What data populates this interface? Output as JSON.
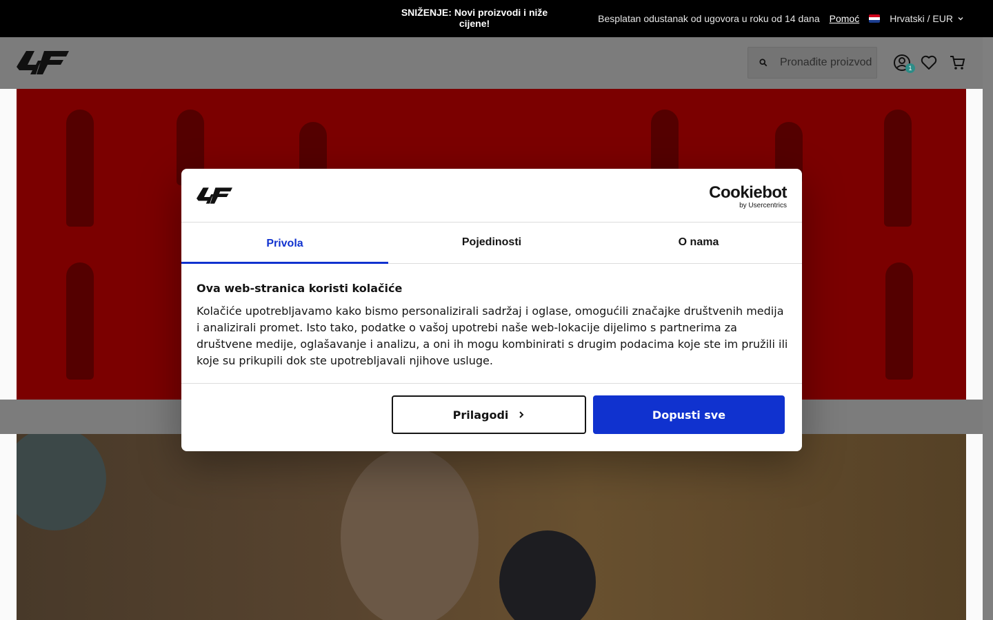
{
  "topbar": {
    "promo": "SNIŽENJE: Novi proizvodi i niže cijene!",
    "returns": "Besplatan odustanak od ugovora u roku od 14 dana",
    "help": "Pomoć",
    "language": "Hrvatski / EUR"
  },
  "header": {
    "logo": "4F",
    "search_placeholder": "Pronađite proizvod",
    "cart_badge": "1"
  },
  "cookie_dialog": {
    "brand": "Cookiebot",
    "brand_sub": "by Usercentrics",
    "tabs": [
      {
        "label": "Privola",
        "active": true
      },
      {
        "label": "Pojedinosti",
        "active": false
      },
      {
        "label": "O nama",
        "active": false
      }
    ],
    "heading": "Ova web-stranica koristi kolačiće",
    "body": "Kolačiće upotrebljavamo kako bismo personalizirali sadržaj i oglase, omogućili značajke društvenih medija i analizirali promet. Isto tako, podatke o vašoj upotrebi naše web-lokacije dijelimo s partnerima za društvene medije, oglašavanje i analizu, a oni ih mogu kombinirati s drugim podacima koje ste im pružili ili koje su prikupili dok ste upotrebljavali njihove usluge.",
    "customize_label": "Prilagodi",
    "allow_all_label": "Dopusti sve"
  },
  "colors": {
    "primary": "#1032cf",
    "topbar": "#000000",
    "hero_red": "#7e0000"
  }
}
